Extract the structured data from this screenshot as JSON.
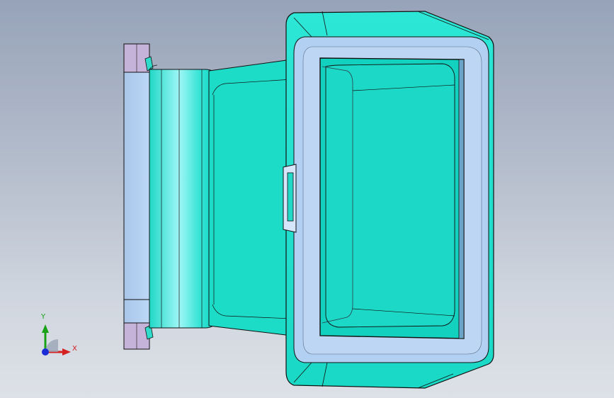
{
  "viewport": {
    "background_top": "#97a3b9",
    "background_bottom": "#dde1e7"
  },
  "model": {
    "body_color": "#1fe0cc",
    "flange_color": "#b4d3f4",
    "highlight_color": "#ccd9f2",
    "edge_color": "#111111",
    "visible_faces": [
      "mounting-flange",
      "tapered-duct-body",
      "rectangular-rim",
      "inner-opening"
    ]
  },
  "triad": {
    "x_label": "X",
    "y_label": "Y",
    "x_color": "#d42020",
    "y_color": "#18a018",
    "z_color": "#1a2cd6",
    "icons": [
      "x-axis-arrow-icon",
      "y-axis-arrow-icon",
      "z-axis-dot-icon"
    ]
  }
}
